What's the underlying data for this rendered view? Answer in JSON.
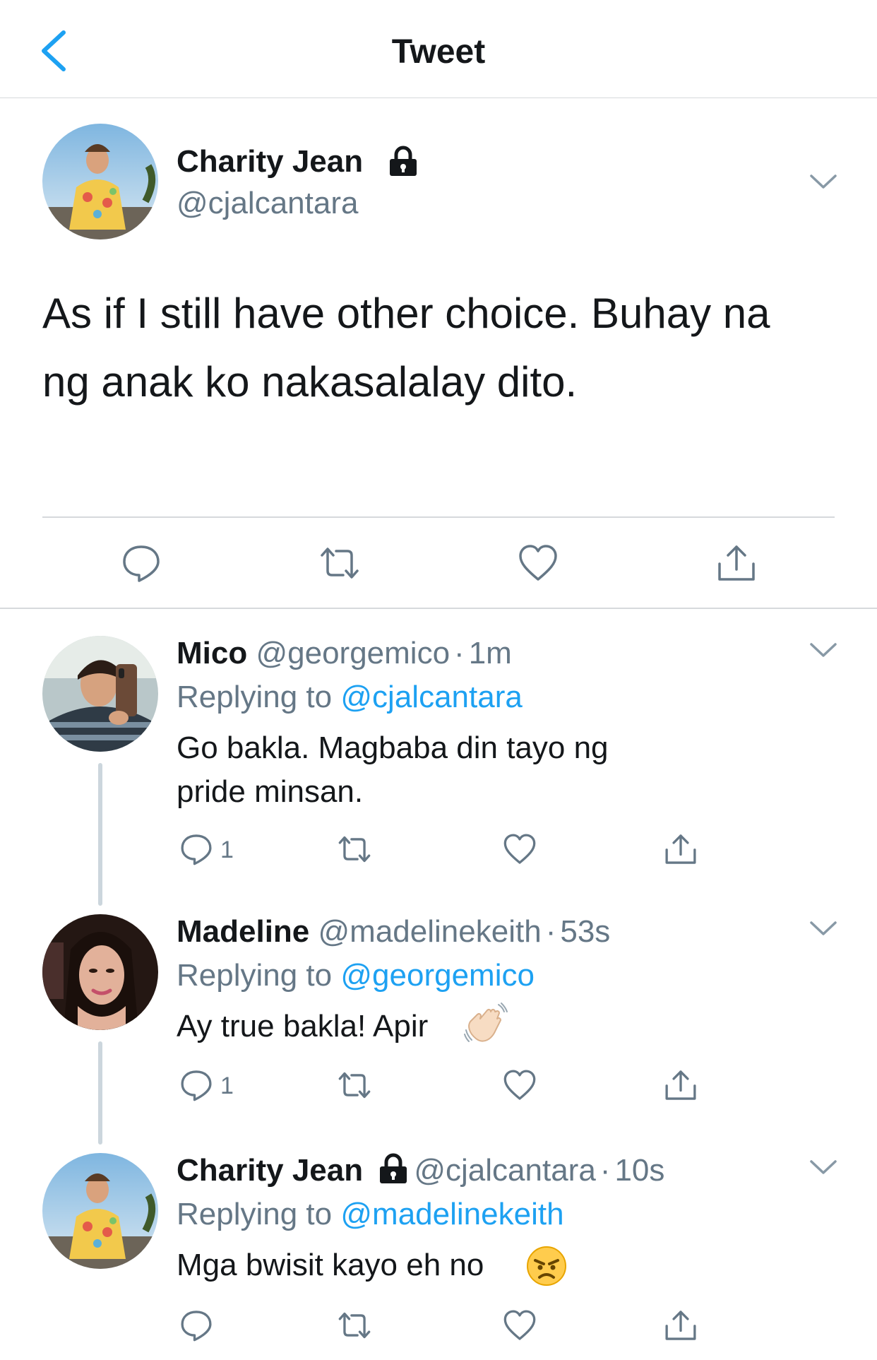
{
  "header": {
    "title": "Tweet"
  },
  "main_tweet": {
    "name": "Charity Jean",
    "handle": "@cjalcantara",
    "text_line1": "As if I still have other choice. Buhay na",
    "text_line2": "ng anak ko nakasalalay dito."
  },
  "replies": [
    {
      "name": "Mico",
      "handle": "@georgemico",
      "dot": "·",
      "time": "1m",
      "replying_prefix": "Replying to",
      "replying_to": "@cjalcantara",
      "text_line1": "Go bakla. Magbaba din tayo ng",
      "text_line2": "pride minsan.",
      "reply_count": "1"
    },
    {
      "name": "Madeline",
      "handle": "@madelinekeith",
      "dot": "·",
      "time": "53s",
      "replying_prefix": "Replying to",
      "replying_to": "@georgemico",
      "text_line1": "Ay true bakla! Apir",
      "reply_count": "1"
    },
    {
      "name": "Charity Jean",
      "handle": "@cjalcantara",
      "dot": "·",
      "time": "10s",
      "replying_prefix": "Replying to",
      "replying_to": "@madelinekeith",
      "text_line1": "Mga bwisit kayo eh no"
    }
  ],
  "icons": {
    "back": "chevron-left-icon",
    "lock": "lock-icon",
    "menu": "chevron-down-icon",
    "reply": "reply-icon",
    "retweet": "retweet-icon",
    "like": "heart-icon",
    "share": "share-icon",
    "wave_emoji": "waving-hand-emoji",
    "angry_emoji": "angry-face-emoji"
  },
  "colors": {
    "accent": "#1da1f2",
    "text": "#14171a",
    "secondary": "#657786",
    "divider": "#d6d9dc"
  }
}
